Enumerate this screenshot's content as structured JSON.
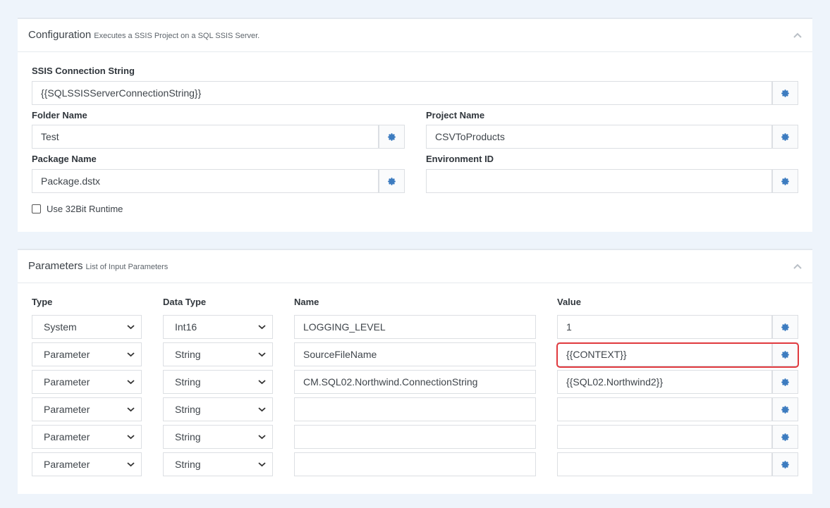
{
  "configuration": {
    "title": "Configuration",
    "subtitle": "Executes a SSIS Project on a SQL SSIS Server.",
    "connection_label": "SSIS Connection String",
    "connection_value": "{{SQLSSISServerConnectionString}}",
    "folder_label": "Folder Name",
    "folder_value": "Test",
    "project_label": "Project Name",
    "project_value": "CSVToProducts",
    "package_label": "Package Name",
    "package_value": "Package.dstx",
    "environment_label": "Environment ID",
    "environment_value": "",
    "runtime_label": "Use 32Bit Runtime",
    "runtime_checked": false
  },
  "parameters": {
    "title": "Parameters",
    "subtitle": "List of Input Parameters",
    "headers": {
      "type": "Type",
      "data_type": "Data Type",
      "name": "Name",
      "value": "Value"
    },
    "rows": [
      {
        "type": "System",
        "data_type": "Int16",
        "name": "LOGGING_LEVEL",
        "value": "1"
      },
      {
        "type": "Parameter",
        "data_type": "String",
        "name": "SourceFileName",
        "value": "{{CONTEXT}}"
      },
      {
        "type": "Parameter",
        "data_type": "String",
        "name": "CM.SQL02.Northwind.ConnectionString",
        "value": "{{SQL02.Northwind2}}"
      },
      {
        "type": "Parameter",
        "data_type": "String",
        "name": "",
        "value": ""
      },
      {
        "type": "Parameter",
        "data_type": "String",
        "name": "",
        "value": ""
      },
      {
        "type": "Parameter",
        "data_type": "String",
        "name": "",
        "value": ""
      }
    ]
  },
  "colors": {
    "accent": "#3d7cc0",
    "highlight": "#e0393e",
    "page_bg": "#eef4fb"
  },
  "icons": {
    "settings": "gear-icon",
    "collapse": "chevron-up-icon",
    "dropdown": "chevron-down-icon"
  }
}
